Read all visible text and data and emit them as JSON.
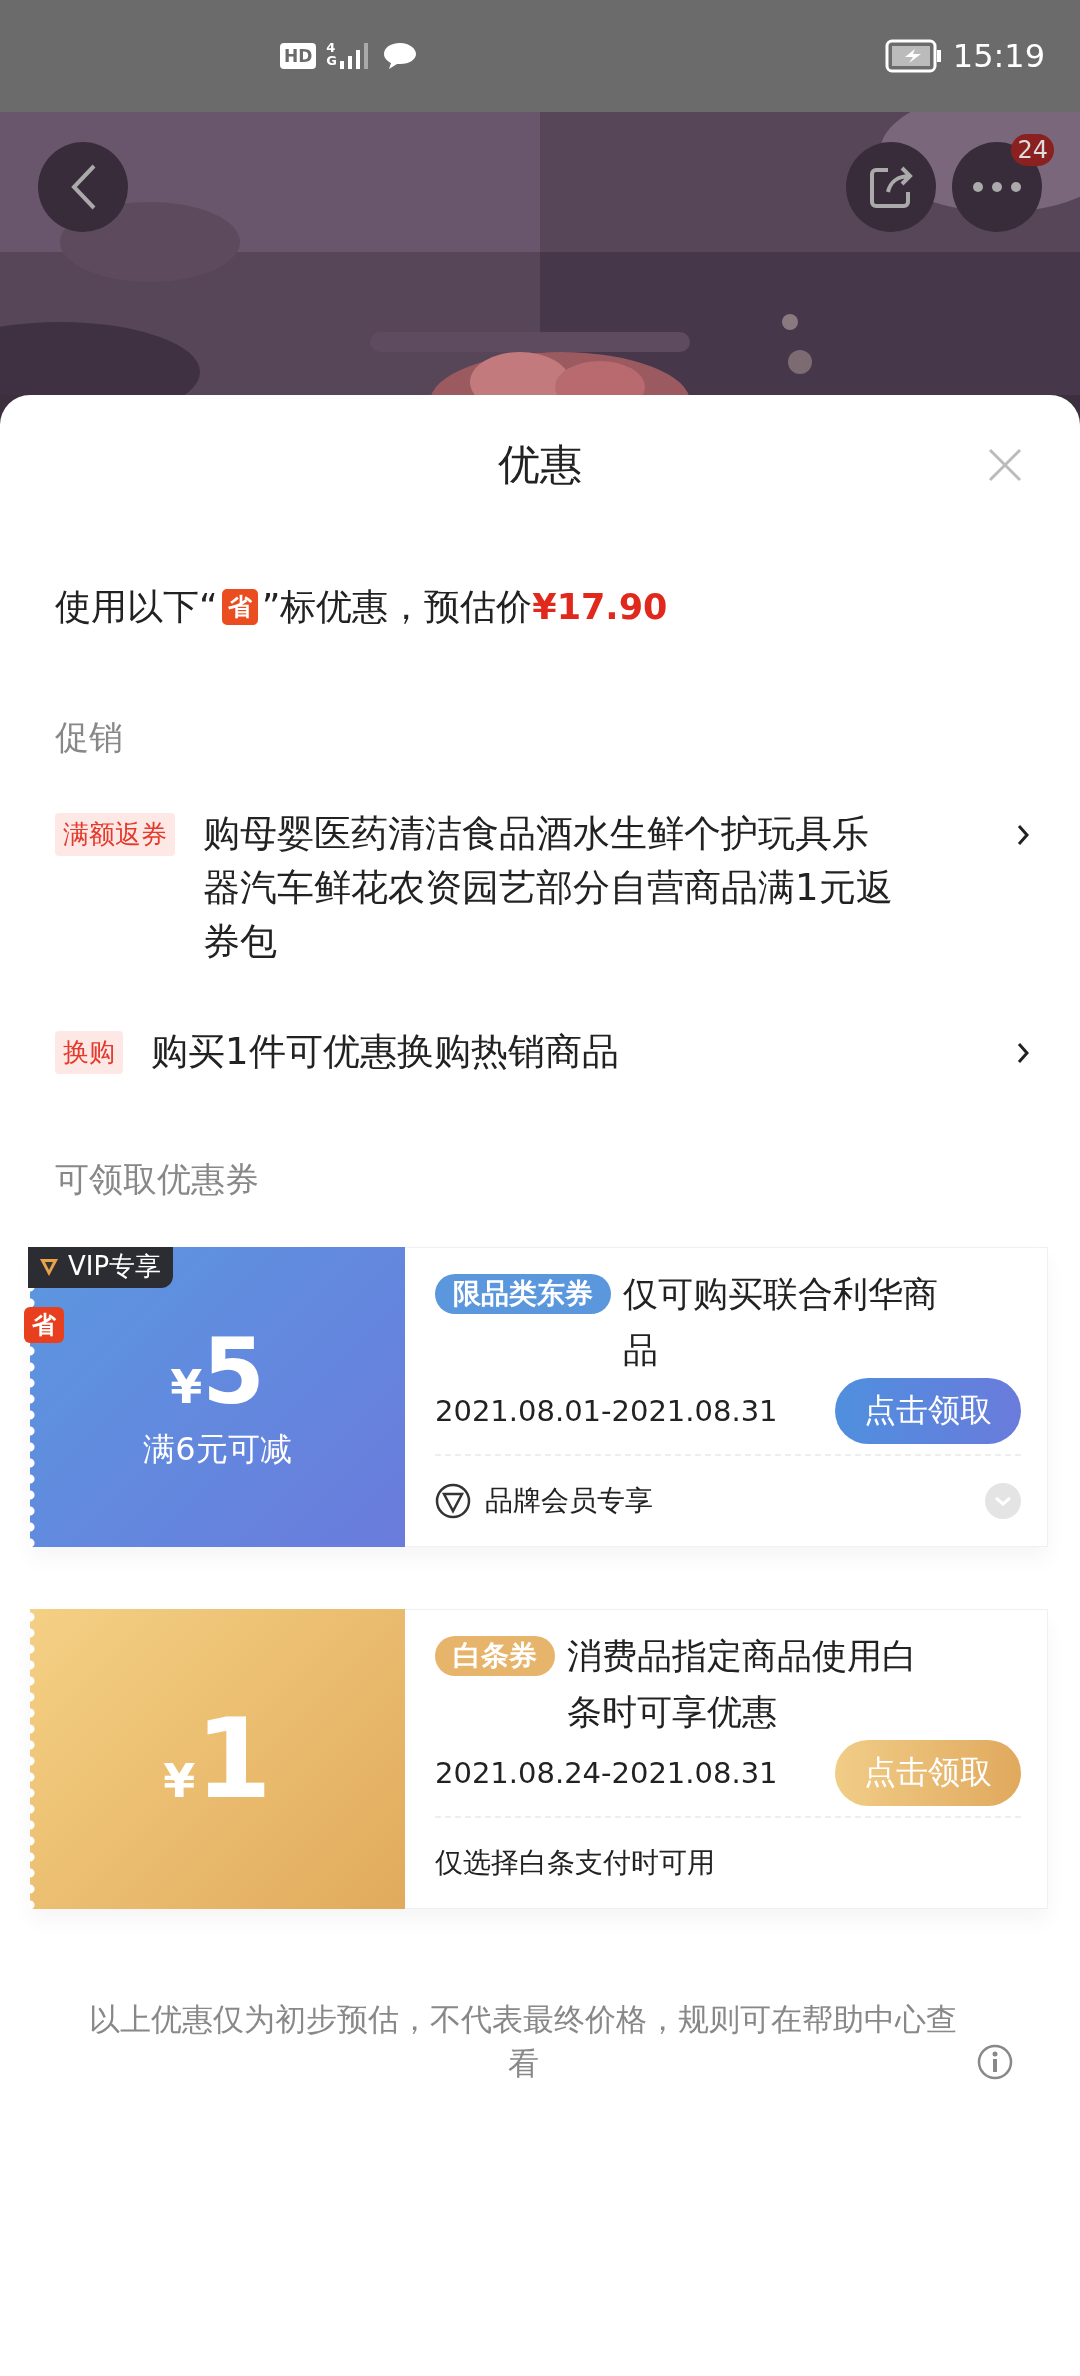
{
  "status_bar": {
    "hd": "HD",
    "network": "4G",
    "time": "15:19"
  },
  "header": {
    "more_badge": "24"
  },
  "sheet": {
    "title": "优惠",
    "estimate": {
      "prefix": "使用以下“",
      "badge": "省",
      "suffix": "”标优惠，预估价",
      "price": "¥17.90"
    },
    "promotions_heading": "促销",
    "promotions": [
      {
        "tag": "满额返券",
        "text": "购母婴医药清洁食品酒水生鲜个护玩具乐器汽车鲜花农资园艺部分自营商品满1元返券包"
      },
      {
        "tag": "换购",
        "text": "购买1件可优惠换购热销商品"
      }
    ],
    "coupons_heading": "可领取优惠券",
    "coupons": [
      {
        "kind": "vip",
        "vip_label": "VIP专享",
        "save_badge": "省",
        "currency": "¥",
        "amount": "5",
        "condition": "满6元可减",
        "tag": "限品类东券",
        "title": "仅可购买联合利华商品",
        "dates": "2021.08.01-2021.08.31",
        "button": "点击领取",
        "note": "品牌会员专享",
        "expandable": true
      },
      {
        "kind": "baitiao",
        "currency": "¥",
        "amount": "1",
        "tag": "白条券",
        "title": "消费品指定商品使用白条时可享优惠",
        "dates": "2021.08.24-2021.08.31",
        "button": "点击领取",
        "note": "仅选择白条支付时可用",
        "expandable": false
      }
    ],
    "footer": "以上优惠仅为初步预估，不代表最终价格，规则可在帮助中心查看"
  }
}
